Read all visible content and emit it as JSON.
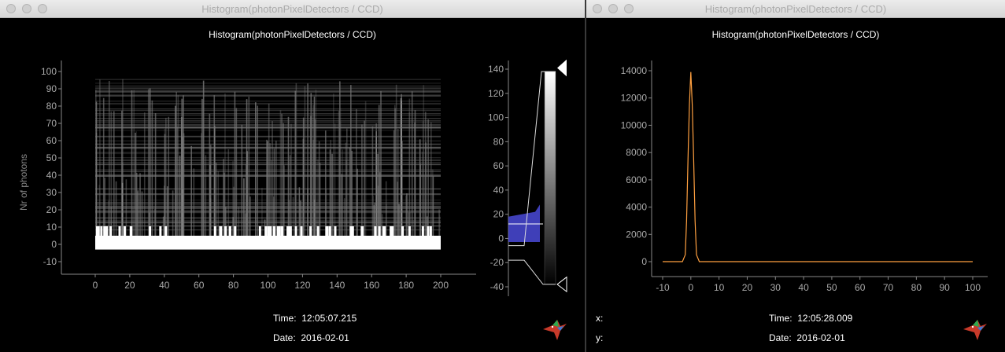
{
  "left_window": {
    "titlebar": "Histogram(photonPixelDetectors / CCD)",
    "plot_title": "Histogram(photonPixelDetectors / CCD)",
    "ylabel": "Nr of photons",
    "x_ticks": [
      "0",
      "20",
      "40",
      "60",
      "80",
      "100",
      "120",
      "140",
      "160",
      "180",
      "200"
    ],
    "y_ticks": [
      "-10",
      "0",
      "10",
      "20",
      "30",
      "40",
      "50",
      "60",
      "70",
      "80",
      "90",
      "100"
    ],
    "colorbar_ticks": [
      "-40",
      "-20",
      "0",
      "20",
      "40",
      "60",
      "80",
      "100",
      "120",
      "140"
    ],
    "time_label": "Time:",
    "time_value": "12:05:07.215",
    "date_label": "Date:",
    "date_value": "2016-02-01"
  },
  "right_window": {
    "titlebar": "Histogram(photonPixelDetectors / CCD)",
    "plot_title": "Histogram(photonPixelDetectors / CCD)",
    "x_ticks": [
      "-10",
      "0",
      "10",
      "20",
      "30",
      "40",
      "50",
      "60",
      "70",
      "80",
      "90",
      "100"
    ],
    "y_ticks": [
      "0",
      "2000",
      "4000",
      "6000",
      "8000",
      "10000",
      "12000",
      "14000"
    ],
    "x_label": "x:",
    "y_label": "y:",
    "time_label": "Time:",
    "time_value": "12:05:28.009",
    "date_label": "Date:",
    "date_value": "2016-02-01"
  },
  "chart_data": [
    {
      "type": "heatmap",
      "title": "Histogram(photonPixelDetectors / CCD)",
      "xlabel": "",
      "ylabel": "Nr of photons",
      "xlim": [
        -10,
        220
      ],
      "ylim": [
        -15,
        105
      ],
      "colormap": "grayscale",
      "colorbar_range": [
        -45,
        145
      ]
    },
    {
      "type": "line",
      "title": "Histogram(photonPixelDetectors / CCD)",
      "xlim": [
        -13,
        103
      ],
      "ylim": [
        -800,
        14800
      ],
      "color": "#ffa040",
      "x": [
        -10,
        -3,
        -2,
        -1.5,
        -1,
        -0.5,
        0,
        0.5,
        1,
        1.5,
        2,
        3,
        10,
        100
      ],
      "values": [
        0,
        0,
        500,
        3000,
        7500,
        11500,
        13900,
        11500,
        7500,
        3000,
        500,
        0,
        0,
        0
      ]
    }
  ],
  "colors": {
    "accent": "#4a4ad8",
    "line": "#ffa040"
  }
}
